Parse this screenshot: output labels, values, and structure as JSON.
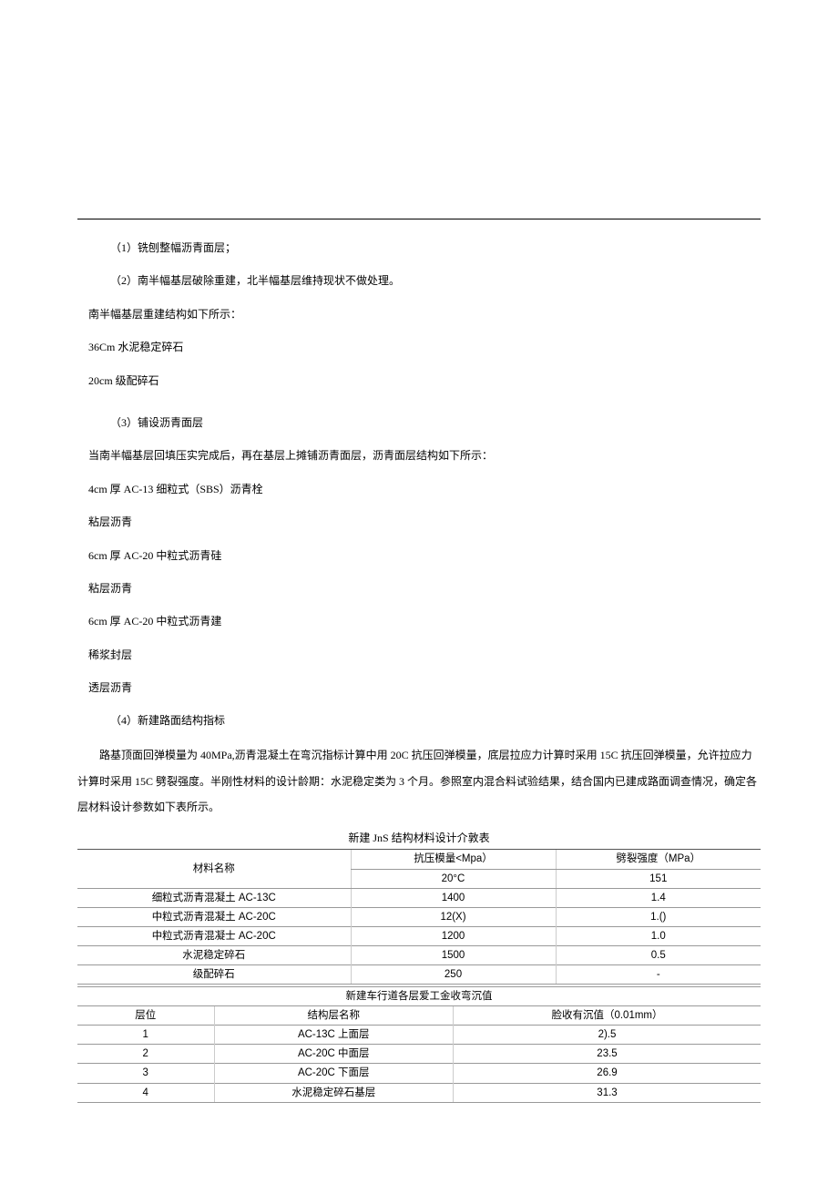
{
  "lines": {
    "l1": "（1）铣刨整幅沥青面层；",
    "l2": "（2）南半幅基层破除重建，北半幅基层维持现状不做处理。",
    "l3": "南半幅基层重建结构如下所示：",
    "l4": "36Cm 水泥稳定碎石",
    "l5": "20cm 级配碎石",
    "l6": "（3）铺设沥青面层",
    "l7": "当南半幅基层回填压实完成后，再在基层上摊铺沥青面层，沥青面层结构如下所示：",
    "l8": "4cm 厚 AC-13 细粒式（SBS）沥青栓",
    "l9": "粘层沥青",
    "l10": "6cm 厚 AC-20 中粒式沥青硅",
    "l11": "粘层沥青",
    "l12": "6cm 厚 AC-20 中粒式沥青建",
    "l13": "稀浆封层",
    "l14": "透层沥青",
    "l15": "（4）新建路面结构指标",
    "l16": "路基顶面回弹模量为 40MPa,沥青混凝土在弯沉指标计算中用 20C 抗压回弹模量，底层拉应力计算时采用 15C 抗压回弹模量，允许拉应力计算时采用 15C 劈裂强度。半刚性材料的设计龄期：水泥稳定类为 3 个月。参照室内混合料试验结果，结合国内已建成路面调查情况，确定各层材料设计参数如下表所示。"
  },
  "table1": {
    "title": "新建 JnS 结构材料设计介敦表",
    "h_material": "材料名称",
    "h_modulus": "抗压模量<Mpa）",
    "h_split": "劈裂强度（MPa）",
    "h_20c": "20°C",
    "h_151": "151",
    "rows": [
      {
        "name": "细粒式沥青混凝土 AC-13C",
        "modulus": "1400",
        "split": "1.4"
      },
      {
        "name": "中粒式沥青混凝土 AC-20C",
        "modulus": "12(X)",
        "split": "1.()"
      },
      {
        "name": "中粒式沥青混凝士 AC-20C",
        "modulus": "1200",
        "split": "1.0"
      },
      {
        "name": "水泥稳定碎石",
        "modulus": "1500",
        "split": "0.5"
      },
      {
        "name": "级配碎石",
        "modulus": "250",
        "split": "-"
      }
    ]
  },
  "table2": {
    "title": "新建车行道各层爱工金收弯沉值",
    "h_pos": "层位",
    "h_layer": "结构层名称",
    "h_val": "脸收有沉值（0.01mm）",
    "rows": [
      {
        "pos": "1",
        "layer": "AC-13C 上面层",
        "val": "2).5"
      },
      {
        "pos": "2",
        "layer": "AC-20C 中面层",
        "val": "23.5"
      },
      {
        "pos": "3",
        "layer": "AC-20C 下面层",
        "val": "26.9"
      },
      {
        "pos": "4",
        "layer": "水泥稳定碎石基层",
        "val": "31.3"
      }
    ]
  }
}
